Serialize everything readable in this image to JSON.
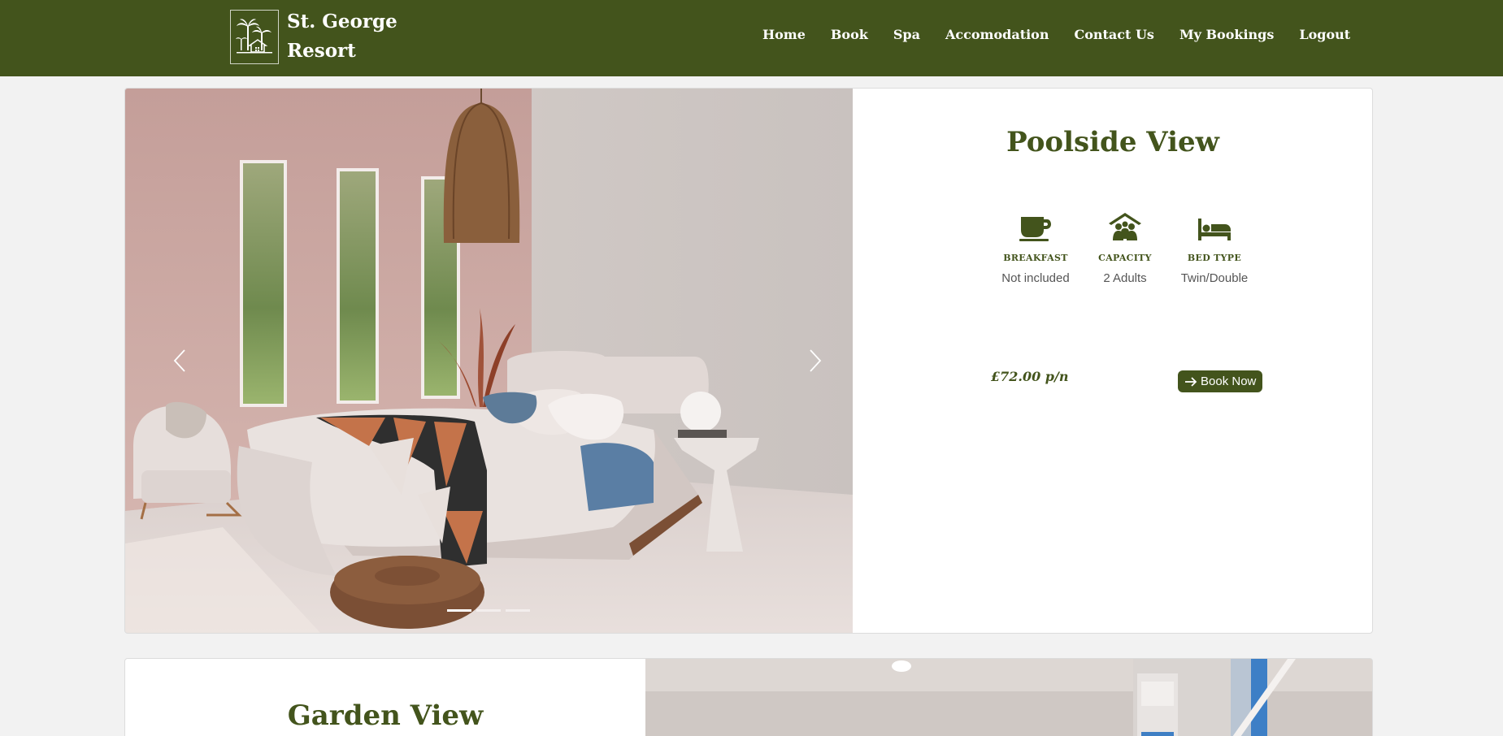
{
  "brand": {
    "name": "St. George Resort",
    "logo_icon": "palm-trees-house-icon"
  },
  "nav": {
    "items": [
      {
        "label": "Home"
      },
      {
        "label": "Book"
      },
      {
        "label": "Spa"
      },
      {
        "label": "Accomodation"
      },
      {
        "label": "Contact Us"
      },
      {
        "label": "My Bookings"
      },
      {
        "label": "Logout"
      }
    ]
  },
  "rooms": [
    {
      "title": "Poolside View",
      "amenities": [
        {
          "icon": "coffee-icon",
          "label": "BREAKFAST",
          "value": "Not included"
        },
        {
          "icon": "group-icon",
          "label": "CAPACITY",
          "value": "2 Adults"
        },
        {
          "icon": "bed-icon",
          "label": "BED TYPE",
          "value": "Twin/Double"
        }
      ],
      "price": "£72.00 p/n",
      "book_label": "Book Now",
      "carousel": {
        "slides": 3,
        "active_index": 0
      }
    },
    {
      "title": "Garden View"
    }
  ],
  "colors": {
    "brand_green": "#43541c",
    "background": "#f2f2f2"
  }
}
